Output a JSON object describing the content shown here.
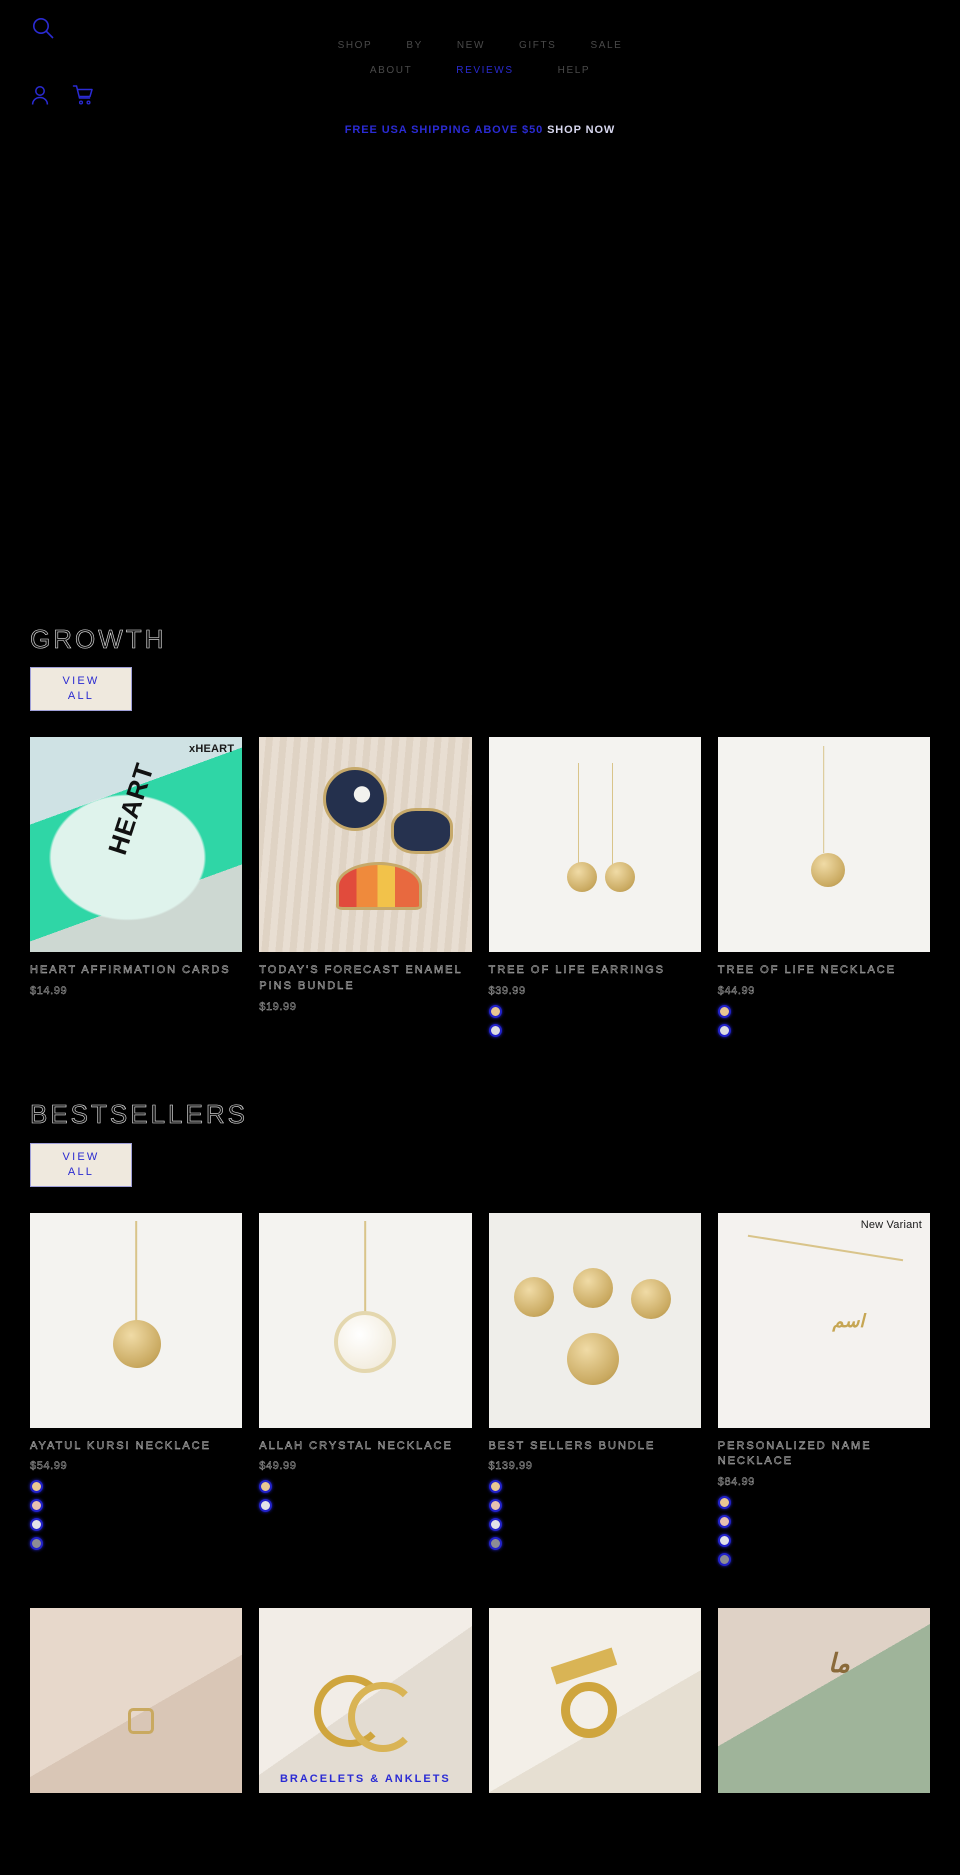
{
  "header": {
    "search_icon": "search-icon",
    "account_icon": "user-account-icon",
    "cart_icon": "shopping-cart-icon",
    "nav_row1": [
      {
        "label": "SHOP",
        "style": "dim"
      },
      {
        "label": "BY",
        "style": "dim"
      },
      {
        "label": "NEW",
        "style": "dim"
      },
      {
        "label": "GIFTS",
        "style": "dim"
      },
      {
        "label": "SALE",
        "style": "dim"
      }
    ],
    "nav_row2": [
      {
        "label": "ABOUT",
        "style": "dim"
      },
      {
        "label": "REVIEWS",
        "style": "accent"
      },
      {
        "label": "HELP",
        "style": "dim"
      }
    ],
    "promo": {
      "text": "FREE USA SHIPPING ABOVE $50 ",
      "cta": "SHOP NOW"
    }
  },
  "sections": [
    {
      "title": "GROWTH",
      "view_all": "VIEW\nALL",
      "view_all_line1": "VIEW",
      "view_all_line2": "ALL",
      "products": [
        {
          "title": "HEART AFFIRMATION CARDS",
          "price": "$14.99",
          "badge": "xHEART",
          "badge_bold": true,
          "swatches": []
        },
        {
          "title": "TODAY'S FORECAST ENAMEL PINS BUNDLE",
          "price": "$19.99",
          "badge": "",
          "swatches": []
        },
        {
          "title": "TREE OF LIFE EARRINGS",
          "price": "$39.99",
          "badge": "",
          "swatches": [
            "#e8c792",
            "#dcdce2"
          ]
        },
        {
          "title": "TREE OF LIFE NECKLACE",
          "price": "$44.99",
          "badge": "",
          "swatches": [
            "#e8c792",
            "#dcdce2"
          ]
        }
      ]
    },
    {
      "title": "BESTSELLERS",
      "view_all_line1": "VIEW",
      "view_all_line2": "ALL",
      "products": [
        {
          "title": "AYATUL KURSI NECKLACE",
          "price": "$54.99",
          "badge": "",
          "swatches": [
            "#e8c792",
            "#e7c0b0",
            "#e2e2e8",
            "#8d8d94"
          ]
        },
        {
          "title": "ALLAH CRYSTAL NECKLACE",
          "price": "$49.99",
          "badge": "",
          "swatches": [
            "#e8c792",
            "#e2e2e8"
          ]
        },
        {
          "title": "BEST SELLERS  BUNDLE",
          "price": "$139.99",
          "badge": "",
          "swatches": [
            "#e8c792",
            "#e7c0b0",
            "#e2e2e8",
            "#8d8d94"
          ]
        },
        {
          "title": "PERSONALIZED NAME NECKLACE",
          "price": "$84.99",
          "badge": "New Variant",
          "badge_bold": false,
          "swatches": [
            "#e8c792",
            "#e7c0b0",
            "#e2e2e8",
            "#8d8d94"
          ]
        }
      ]
    }
  ],
  "categories": [
    {
      "label": ""
    },
    {
      "label": "BRACELETS & ANKLETS"
    },
    {
      "label": ""
    },
    {
      "label": ""
    }
  ]
}
